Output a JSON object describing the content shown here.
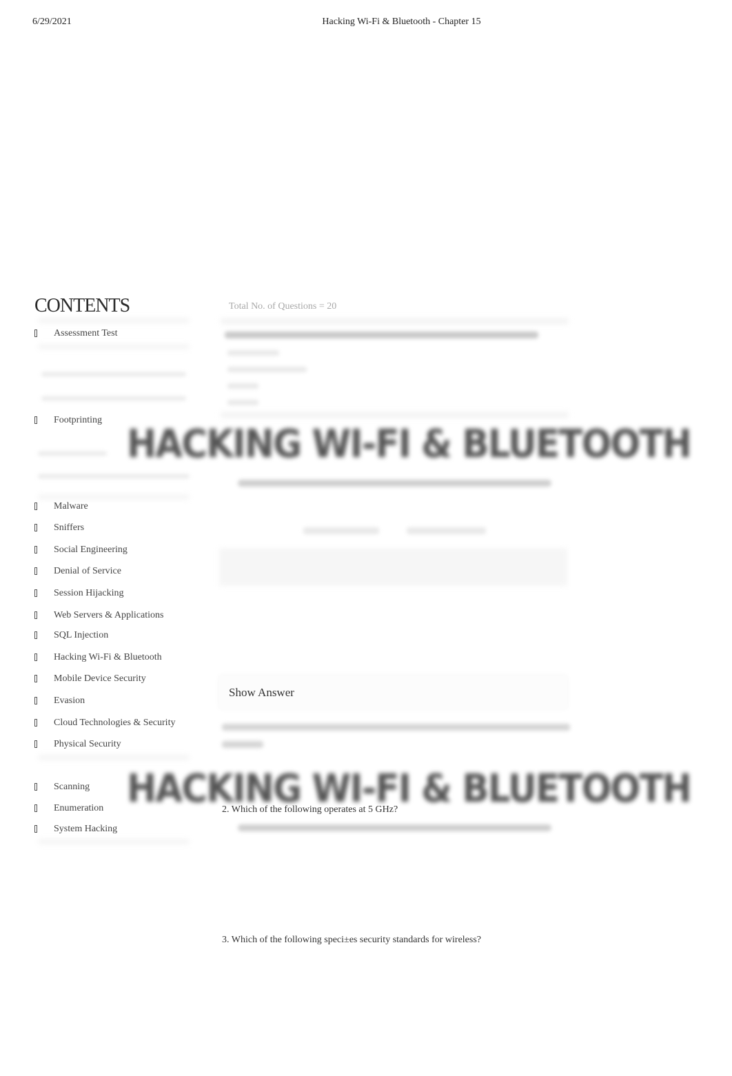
{
  "header": {
    "date": "6/29/2021",
    "title": "Hacking Wi-Fi & Bluetooth - Chapter 15"
  },
  "sidebar": {
    "title": "CONTENTS",
    "items": [
      {
        "label": "Assessment Test",
        "icon": "caret-icon"
      },
      {
        "label": "Footprinting",
        "icon": "caret-icon"
      },
      {
        "label": "Malware",
        "icon": "caret-icon"
      },
      {
        "label": "Sniffers",
        "icon": "caret-icon"
      },
      {
        "label": "Social Engineering",
        "icon": "caret-icon"
      },
      {
        "label": "Denial of Service",
        "icon": "caret-icon"
      },
      {
        "label": "Session Hijacking",
        "icon": "caret-icon"
      },
      {
        "label": "Web Servers & Applications",
        "icon": "caret-icon"
      },
      {
        "label": "SQL Injection",
        "icon": "caret-icon"
      },
      {
        "label": "Hacking Wi-Fi & Bluetooth",
        "icon": "caret-icon"
      },
      {
        "label": "Mobile Device Security",
        "icon": "caret-icon"
      },
      {
        "label": "Evasion",
        "icon": "caret-icon"
      },
      {
        "label": "Cloud Technologies & Security",
        "icon": "caret-icon"
      },
      {
        "label": "Physical Security",
        "icon": "caret-icon"
      },
      {
        "label": "Scanning",
        "icon": "caret-icon"
      },
      {
        "label": "Enumeration",
        "icon": "caret-icon"
      },
      {
        "label": "System Hacking",
        "icon": "caret-icon"
      }
    ]
  },
  "main": {
    "total_questions": "Total No. of Questions = 20",
    "banner_text": "HACKING WI-FI & BLUETOOTH",
    "show_answer_label": "Show Answer",
    "questions": [
      {
        "text": "2. Which of the following operates at 5 GHz?"
      },
      {
        "text": "3. Which of the following speci±es security standards for wireless?"
      }
    ]
  }
}
